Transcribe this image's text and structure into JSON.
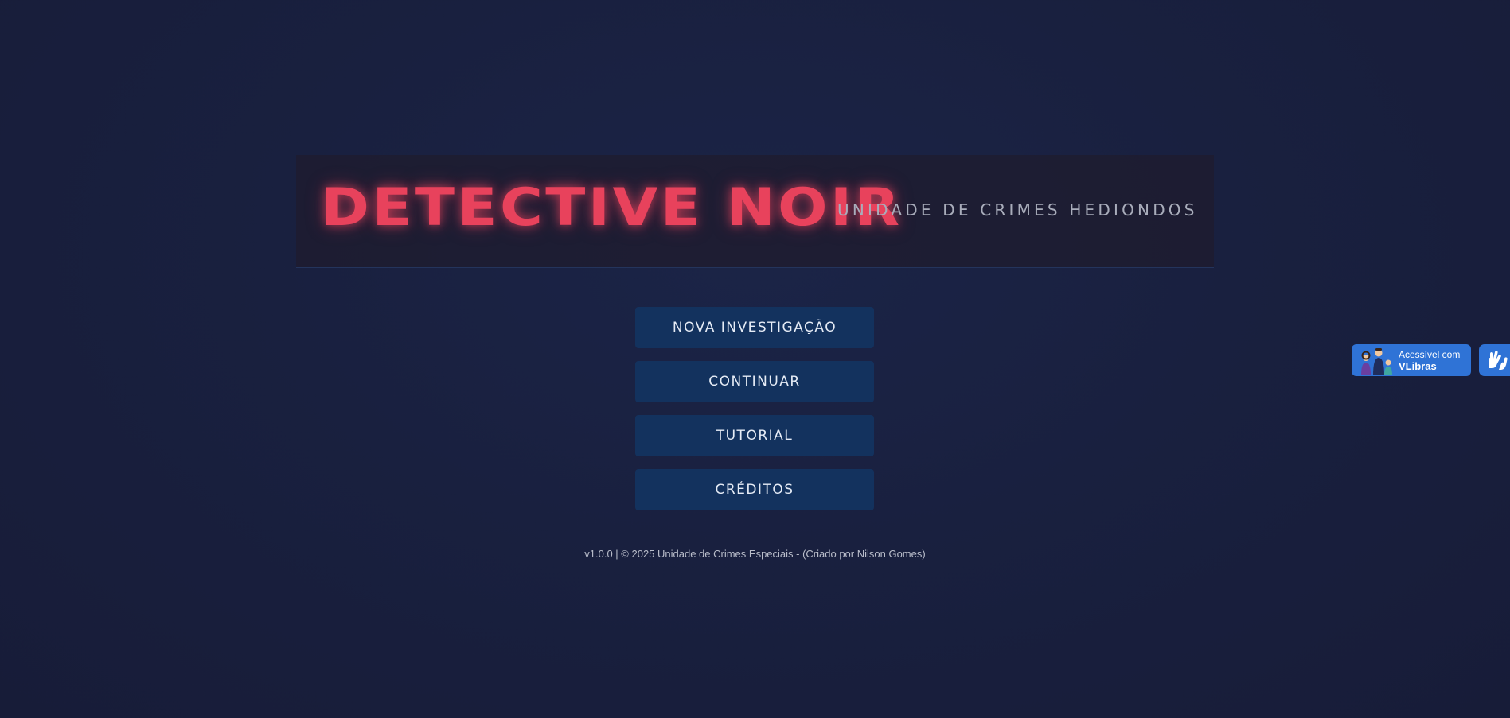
{
  "header": {
    "title": "DETECTIVE NOIR",
    "subtitle": "UNIDADE DE CRIMES HEDIONDOS"
  },
  "menu": {
    "buttons": [
      {
        "label": "NOVA INVESTIGAÇÃO"
      },
      {
        "label": "CONTINUAR"
      },
      {
        "label": "TUTORIAL"
      },
      {
        "label": "CRÉDITOS"
      }
    ]
  },
  "footer": {
    "text": "v1.0.0 | © 2025 Unidade de Crimes Especiais - (Criado por Nilson Gomes)"
  },
  "vlibras": {
    "badge_line1": "Acessível com",
    "badge_line2": "VLibras",
    "badge_icon": "people-icon",
    "toggle_icon": "hands-icon"
  },
  "colors": {
    "background": "#19203f",
    "title": "#e8425c",
    "button": "#13325e",
    "accent_blue": "#2f73d6"
  }
}
